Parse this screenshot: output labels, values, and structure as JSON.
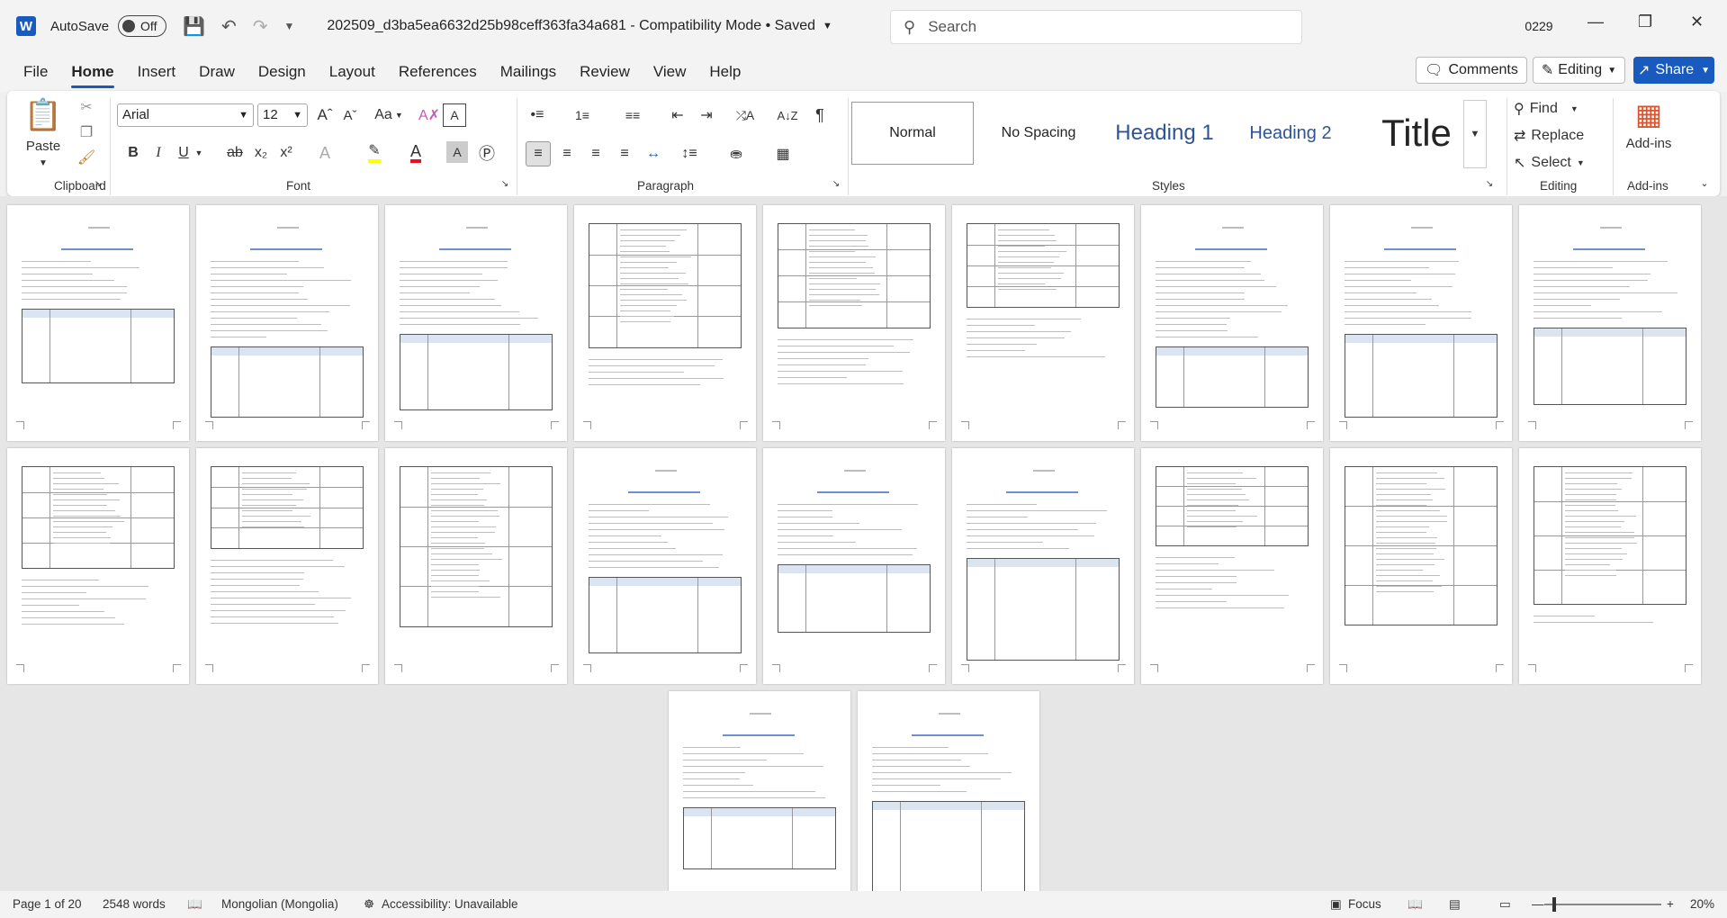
{
  "titlebar": {
    "app_letter": "W",
    "autosave_label": "AutoSave",
    "autosave_state": "Off",
    "doc_title": "202509_d3ba5ea6632d25b98ceff363fa34a681  -  Compatibility Mode • Saved",
    "search_placeholder": "Search",
    "user_initials": "0229"
  },
  "menu": {
    "items": [
      "File",
      "Home",
      "Insert",
      "Draw",
      "Design",
      "Layout",
      "References",
      "Mailings",
      "Review",
      "View",
      "Help"
    ],
    "active": "Home"
  },
  "actions": {
    "comments": "Comments",
    "editing": "Editing",
    "share": "Share"
  },
  "ribbon": {
    "clipboard": {
      "paste": "Paste",
      "label": "Clipboard"
    },
    "font": {
      "family": "Arial",
      "size": "12",
      "label": "Font",
      "change_case": "Aa"
    },
    "paragraph": {
      "label": "Paragraph"
    },
    "styles": {
      "label": "Styles",
      "tiles": [
        "Normal",
        "No Spacing",
        "Heading 1",
        "Heading 2",
        "Title"
      ]
    },
    "editing": {
      "find": "Find",
      "replace": "Replace",
      "select": "Select",
      "label": "Editing"
    },
    "addins": {
      "button": "Add-ins",
      "label": "Add-ins"
    }
  },
  "status": {
    "page": "Page 1 of 20",
    "words": "2548 words",
    "language": "Mongolian (Mongolia)",
    "accessibility": "Accessibility: Unavailable",
    "focus": "Focus",
    "zoom": "20%"
  },
  "colors": {
    "accent": "#185abd",
    "heading": "#2f5496",
    "font_color": "#e81123",
    "highlight": "#ffff00"
  }
}
